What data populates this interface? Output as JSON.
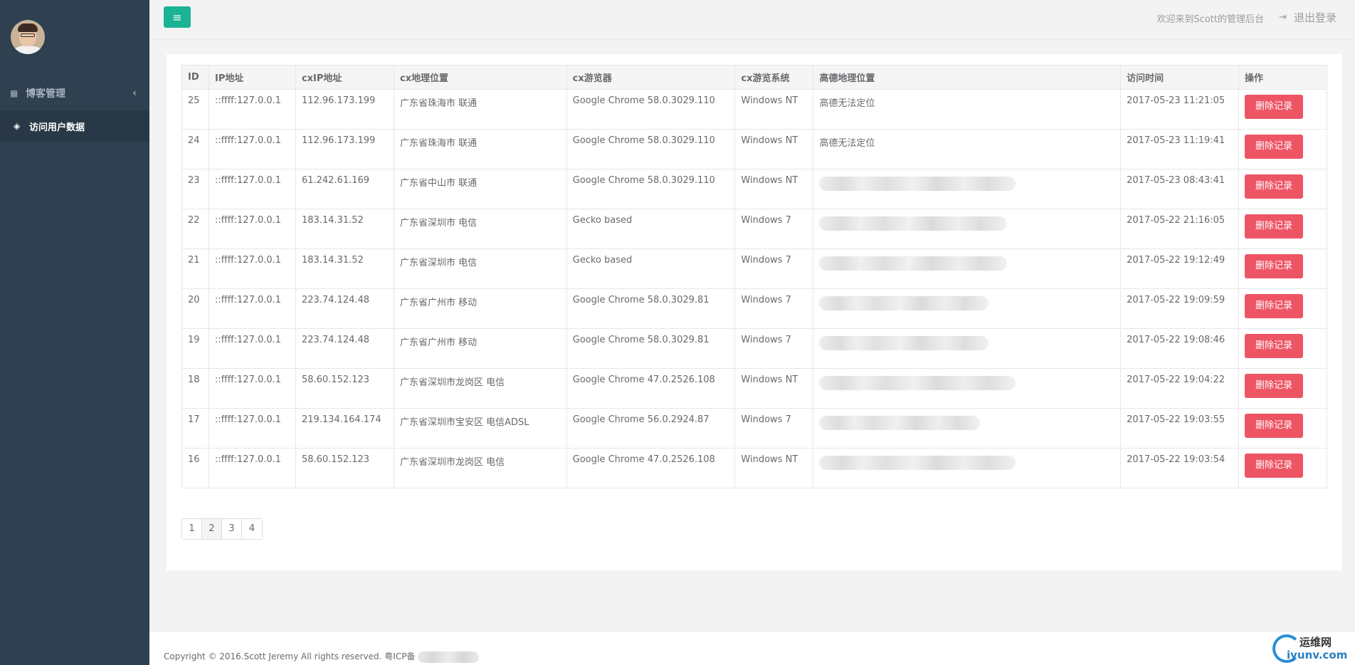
{
  "sidebar": {
    "items": [
      {
        "label": "博客管理",
        "icon": "grid-icon"
      },
      {
        "label": "访问用户数据",
        "icon": "diamond-icon"
      }
    ]
  },
  "topbar": {
    "welcome": "欢迎来到Scott的管理后台",
    "logout": "退出登录"
  },
  "table": {
    "headers": [
      "ID",
      "IP地址",
      "cxIP地址",
      "cx地理位置",
      "cx游览器",
      "cx游览系统",
      "高德地理位置",
      "访问时间",
      "操作"
    ],
    "action_label": "删除记录",
    "rows": [
      {
        "id": "25",
        "ip": "::ffff:127.0.0.1",
        "cxip": "112.96.173.199",
        "loc": "广东省珠海市 联通",
        "browser": "Google Chrome 58.0.3029.110",
        "os": "Windows NT",
        "amap": "高德无法定位",
        "time": "2017-05-23 11:21:05"
      },
      {
        "id": "24",
        "ip": "::ffff:127.0.0.1",
        "cxip": "112.96.173.199",
        "loc": "广东省珠海市 联通",
        "browser": "Google Chrome 58.0.3029.110",
        "os": "Windows NT",
        "amap": "高德无法定位",
        "time": "2017-05-23 11:19:41"
      },
      {
        "id": "23",
        "ip": "::ffff:127.0.0.1",
        "cxip": "61.242.61.169",
        "loc": "广东省中山市 联通",
        "browser": "Google Chrome 58.0.3029.110",
        "os": "Windows NT",
        "amap": "",
        "time": "2017-05-23 08:43:41"
      },
      {
        "id": "22",
        "ip": "::ffff:127.0.0.1",
        "cxip": "183.14.31.52",
        "loc": "广东省深圳市 电信",
        "browser": "Gecko based",
        "os": "Windows 7",
        "amap": "",
        "time": "2017-05-22 21:16:05"
      },
      {
        "id": "21",
        "ip": "::ffff:127.0.0.1",
        "cxip": "183.14.31.52",
        "loc": "广东省深圳市 电信",
        "browser": "Gecko based",
        "os": "Windows 7",
        "amap": "",
        "time": "2017-05-22 19:12:49"
      },
      {
        "id": "20",
        "ip": "::ffff:127.0.0.1",
        "cxip": "223.74.124.48",
        "loc": "广东省广州市 移动",
        "browser": "Google Chrome 58.0.3029.81",
        "os": "Windows 7",
        "amap": "",
        "time": "2017-05-22 19:09:59"
      },
      {
        "id": "19",
        "ip": "::ffff:127.0.0.1",
        "cxip": "223.74.124.48",
        "loc": "广东省广州市 移动",
        "browser": "Google Chrome 58.0.3029.81",
        "os": "Windows 7",
        "amap": "",
        "time": "2017-05-22 19:08:46"
      },
      {
        "id": "18",
        "ip": "::ffff:127.0.0.1",
        "cxip": "58.60.152.123",
        "loc": "广东省深圳市龙岗区 电信",
        "browser": "Google Chrome 47.0.2526.108",
        "os": "Windows NT",
        "amap": "",
        "time": "2017-05-22 19:04:22"
      },
      {
        "id": "17",
        "ip": "::ffff:127.0.0.1",
        "cxip": "219.134.164.174",
        "loc": "广东省深圳市宝安区 电信ADSL",
        "browser": "Google Chrome 56.0.2924.87",
        "os": "Windows 7",
        "amap": "",
        "time": "2017-05-22 19:03:55"
      },
      {
        "id": "16",
        "ip": "::ffff:127.0.0.1",
        "cxip": "58.60.152.123",
        "loc": "广东省深圳市龙岗区 电信",
        "browser": "Google Chrome 47.0.2526.108",
        "os": "Windows NT",
        "amap": "",
        "time": "2017-05-22 19:03:54"
      }
    ]
  },
  "pagination": {
    "pages": [
      "1",
      "2",
      "3",
      "4"
    ],
    "current": "2"
  },
  "footer": {
    "copyright": "Copyright © 2016.Scott Jeremy All rights reserved. 粤ICP备"
  },
  "watermark": {
    "line1": "运维网",
    "line2": "iyunv.com"
  },
  "colors": {
    "sidebar": "#2f4050",
    "accent": "#1ab394",
    "danger": "#ed5565"
  }
}
